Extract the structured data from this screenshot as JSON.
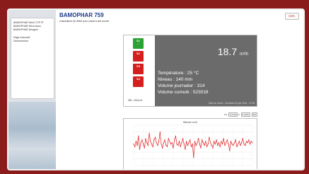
{
  "sidebar": {
    "items": [
      "BAMOPHAR Déch TCP IP",
      "BAMOPHAR Déch Asso",
      "BAMOPHAR Desgrez",
      "Page d'accueil",
      "Déconnexion"
    ]
  },
  "header": {
    "title": "BAMOPHAR 759",
    "subtitle": "Calculateur de débit pour canal à ciel ouvert",
    "top_button": "EXPL"
  },
  "states": [
    {
      "code": "S1",
      "status": "ok"
    },
    {
      "code": "S2",
      "status": "alarm"
    },
    {
      "code": "S3",
      "status": "alarm"
    },
    {
      "code": "S4",
      "status": "alarm"
    }
  ],
  "device_id": "ISB : 2024-04",
  "display": {
    "flow_value": "18.7",
    "flow_unit": "m³/h",
    "temperature": "Température : 25 °C",
    "level": "Niveau : 140 mm",
    "daily_volume": "Volume journalier : 314",
    "cumulative_volume": "Volume cumulé : 523016",
    "last_update": "Date du relevé : Vendredi 26 juin 2024 - 17:26"
  },
  "filters": {
    "from_label": "De",
    "from_value": "0 mn/h",
    "to_label": "à",
    "to_value": "0 mn/h",
    "submit": "OK"
  },
  "chart_data": {
    "type": "line",
    "title": "Mesure m³/h",
    "ylim": [
      0,
      30
    ],
    "series_color": "#e02020",
    "values": [
      16,
      14,
      18,
      15,
      22,
      12,
      17,
      19,
      16,
      13,
      20,
      17,
      15,
      24,
      18,
      16,
      14,
      19,
      21,
      17,
      15,
      18,
      25,
      16,
      13,
      17,
      19,
      15,
      14,
      20,
      18,
      16,
      17,
      13,
      19,
      22,
      16,
      15,
      18,
      14,
      17,
      20,
      16,
      12,
      18,
      15,
      17,
      19,
      14,
      16,
      6,
      18,
      15,
      17,
      20,
      16,
      13,
      19,
      17,
      15,
      18,
      14,
      16,
      21,
      17,
      15,
      13,
      18,
      16,
      19,
      15,
      17,
      14,
      18,
      16,
      20,
      15,
      17,
      19,
      16,
      11,
      18,
      16,
      15,
      17,
      19,
      14,
      16,
      18,
      15,
      17,
      20,
      16,
      15,
      18,
      17,
      19,
      16,
      18,
      17
    ]
  }
}
